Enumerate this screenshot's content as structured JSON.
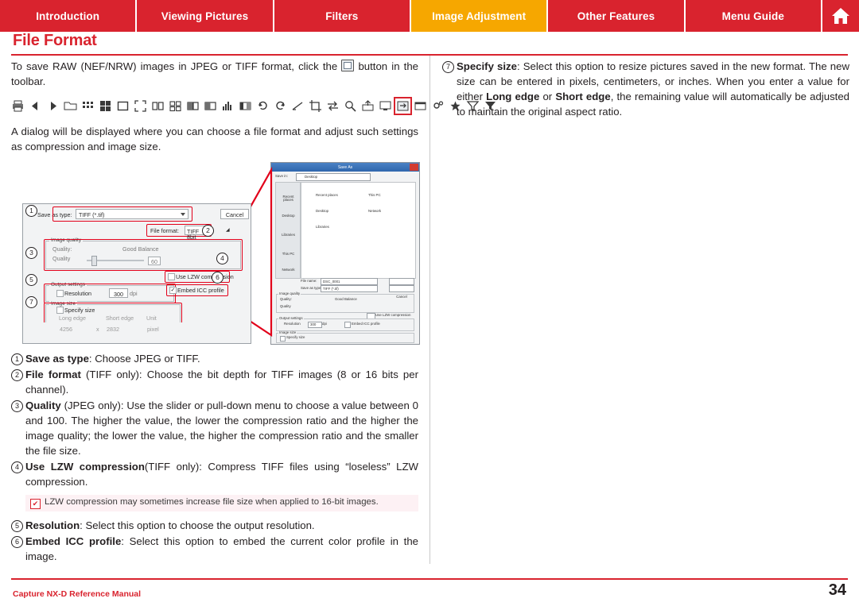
{
  "tabs": [
    {
      "label": "Introduction",
      "active": false
    },
    {
      "label": "Viewing Pictures",
      "active": false
    },
    {
      "label": "Filters",
      "active": false
    },
    {
      "label": "Image Adjustment",
      "active": true
    },
    {
      "label": "Other Features",
      "active": false
    },
    {
      "label": "Menu Guide",
      "active": false
    }
  ],
  "home_icon": "home-icon",
  "page_title": "File Format",
  "left": {
    "para1_a": "To save RAW (NEF/NRW) images in JPEG or TIFF format, click the ",
    "para1_b": " button in the toolbar.",
    "para2": "A dialog will be displayed where you can choose a file format and adjust such settings as compression and image size.",
    "toolbar_icons": [
      "print-icon",
      "back-arrow-icon",
      "forward-arrow-icon",
      "open-folder-icon",
      "grid-view-icon",
      "thumbnail-grid-icon",
      "single-image-icon",
      "fullscreen-icon",
      "two-up-icon",
      "four-up-icon",
      "compare-icon",
      "before-after-icon",
      "histogram-icon",
      "levels-icon",
      "rotate-left-icon",
      "rotate-right-icon",
      "straighten-icon",
      "crop-icon",
      "transfer-icon",
      "zoom-icon",
      "export-icon",
      "convert-files-icon",
      "display-icon",
      "settings-icon",
      "star-rating-icon",
      "filter-icon",
      "sort-filter-icon"
    ],
    "highlight_index": 21
  },
  "dialog": {
    "title": "Save As",
    "save_in_label": "Save in:",
    "save_in_value": "Desktop",
    "places": [
      "Recent places",
      "Desktop",
      "Libraries",
      "This PC",
      "Network"
    ],
    "shortcuts": [
      "Recent places",
      "Desktop",
      "Libraries",
      "This PC",
      "Network"
    ],
    "file_name_label": "File name:",
    "file_name_value": "DSC_0001",
    "save_as_type_label": "Save as type:",
    "save_as_type_value": "TIFF (*.tif)",
    "save_button": "Save",
    "cancel_button": "Cancel",
    "file_format_label": "File format:",
    "file_format_value": "TIFF 8bit",
    "image_quality_group": "Image quality",
    "quality_label": "Quality:",
    "quality_value": "Good Balance",
    "quality_slider_label": "Quality",
    "quality_number": "60",
    "lzw_label": "Use LZW compression",
    "output_settings_group": "Output settings",
    "resolution_label": "Resolution",
    "resolution_value": "300",
    "resolution_unit": "dpi",
    "embed_icc_label": "Embed ICC profile",
    "image_size_group": "Image size",
    "specify_size_label": "Specify size",
    "long_edge_label": "Long edge",
    "short_edge_label": "Short edge",
    "unit_label": "Unit",
    "long_edge_value": "4256",
    "short_edge_value": "2832",
    "unit_value": "pixel",
    "multiply": "x"
  },
  "steps": [
    {
      "num": "1",
      "html": "<b>Save as type</b>: Choose JPEG or TIFF."
    },
    {
      "num": "2",
      "html": "<b>File format</b> (TIFF only): Choose the bit depth for TIFF images (8 or 16 bits per channel)."
    },
    {
      "num": "3",
      "html": "<b>Quality</b> (JPEG only): Use the slider or pull-down menu to choose a value between 0 and 100. The higher the value, the lower the compression ratio and the higher the image quality; the lower the value, the higher the compression ratio and the smaller the file size."
    },
    {
      "num": "4",
      "html": "<b>Use LZW compression</b>(TIFF only): Compress TIFF files using “lose­less” LZW compression."
    },
    {
      "num": "5",
      "html": "<b>Resolution</b>: Select this option to choose the output resolution."
    },
    {
      "num": "6",
      "html": "<b>Embed ICC profile</b>: Select this option to embed the current color profile in the image."
    }
  ],
  "note": {
    "icon": "checkmark-note-icon",
    "text": "LZW compression may sometimes increase file size when applied to 16-bit images."
  },
  "right": {
    "num": "7",
    "html": "<b>Specify size</b>: Select this option to resize pictures saved in the new format. The new size can be entered in pixels, centimeters, or inches. When you enter a value for either <b>Long edge</b> or <b>Short edge</b>, the remaining value will automatically be adjusted to maintain the original aspect ratio."
  },
  "footer": {
    "text": "Capture NX-D Reference Manual",
    "page": "34"
  },
  "colors": {
    "brand_red": "#d9232e",
    "active_tab": "#f6a700",
    "callout_red": "#e2001a",
    "note_bg": "#fdf1f4"
  }
}
